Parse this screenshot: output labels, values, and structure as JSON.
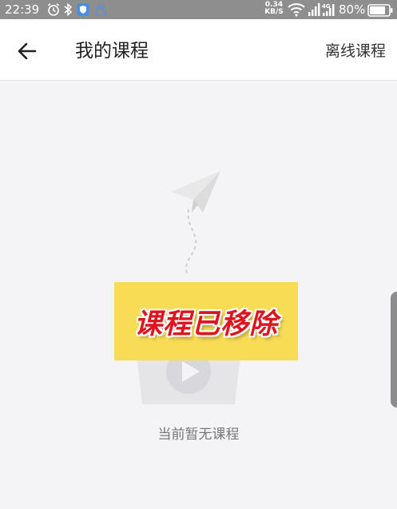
{
  "status_bar": {
    "time": "22:39",
    "network_speed_value": "0.34",
    "network_speed_unit": "KB/S",
    "battery_percent": "80%",
    "icons": [
      "alarm-icon",
      "bluetooth-icon",
      "shield-app-icon",
      "lock-icon",
      "wifi-icon",
      "signal-icon",
      "4g-signal-icon",
      "battery-icon"
    ]
  },
  "header": {
    "title": "我的课程",
    "offline_label": "离线课程",
    "back_icon": "back-arrow-icon"
  },
  "empty_state": {
    "message": "当前暂无课程",
    "illustration_icons": [
      "paper-plane-icon",
      "video-tv-icon"
    ]
  },
  "overlay": {
    "text": "课程已移除",
    "background": "#f8dc55",
    "text_color": "#e0141e"
  },
  "colors": {
    "status_bar": "#8e8e8e",
    "page_background": "#f4f4f6",
    "header_background": "#ffffff"
  }
}
